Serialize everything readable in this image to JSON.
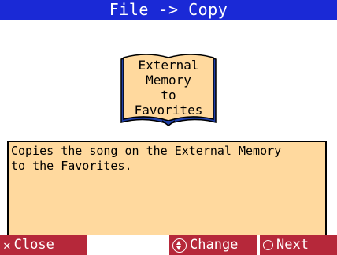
{
  "title": "File -> Copy",
  "book": {
    "lines": [
      "External",
      "Memory",
      "to",
      "Favorites"
    ]
  },
  "description": "Copies the song on the External Memory\nto the Favorites.",
  "footer": {
    "close_label": "Close",
    "change_label": "Change",
    "next_label": "Next"
  },
  "colors": {
    "title_bg": "#1a29d6",
    "book_fill": "#ffd99e",
    "book_edge": "#1f3fa8",
    "desc_bg": "#ffd99e",
    "button_bg": "#b6283a"
  },
  "icons": {
    "close": "x-icon",
    "change": "up-down-dial-icon",
    "next": "circle-icon"
  }
}
